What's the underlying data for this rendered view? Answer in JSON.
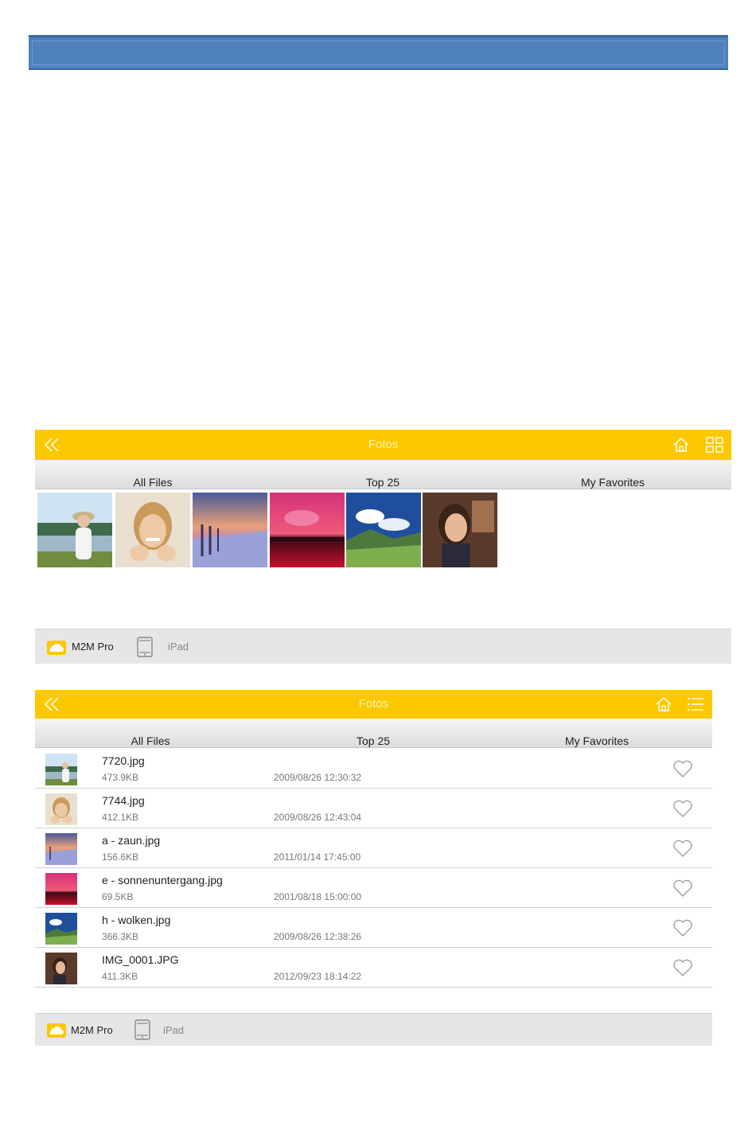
{
  "colors": {
    "banner": "#4f81bd",
    "topbar": "#fcc800",
    "footer": "#e6e6e6"
  },
  "grid_view": {
    "title": "Fotos",
    "tabs": [
      "All Files",
      "Top 25",
      "My Favorites"
    ],
    "footer": {
      "app": "M2M Pro",
      "device": "iPad"
    }
  },
  "list_view": {
    "title": "Fotos",
    "tabs": [
      "All Files",
      "Top 25",
      "My Favorites"
    ],
    "files": [
      {
        "name": "7720.jpg",
        "size": "473.9KB",
        "date": "2009/08/26 12:30:32"
      },
      {
        "name": "7744.jpg",
        "size": "412.1KB",
        "date": "2009/08/26 12:43:04"
      },
      {
        "name": "a - zaun.jpg",
        "size": "156.6KB",
        "date": "2011/01/14 17:45:00"
      },
      {
        "name": "e - sonnenuntergang.jpg",
        "size": "69.5KB",
        "date": "2001/08/18 15:00:00"
      },
      {
        "name": "h - wolken.jpg",
        "size": "366.3KB",
        "date": "2009/08/26 12:38:26"
      },
      {
        "name": "IMG_0001.JPG",
        "size": "411.3KB",
        "date": "2012/09/23 18:14:22"
      }
    ],
    "footer": {
      "app": "M2M Pro",
      "device": "iPad"
    }
  }
}
